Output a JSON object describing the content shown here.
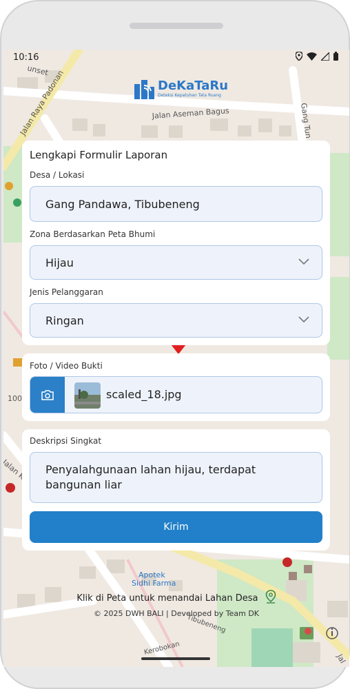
{
  "status_bar": {
    "time": "10:16"
  },
  "app": {
    "name": "DeKaTaRu",
    "tagline": "Deteksi Kepatuhan Tata Ruang"
  },
  "map_labels": {
    "road_1": "Jalan Raya Padonan",
    "road_2": "Jalan Aseman Bagus",
    "road_3": "Gang Tun",
    "road_4": "unset",
    "road_5": "Jalan K",
    "road_6": "Tibubeneng",
    "road_7": "Kerobokan",
    "poi_1": "Apotek",
    "poi_2": "Sidhi Farma",
    "number_1": "100",
    "street_edge": "Jal"
  },
  "form": {
    "title": "Lengkapi Formulir Laporan",
    "location_label": "Desa / Lokasi",
    "location_value": "Gang Pandawa, Tibubeneng",
    "zone_label": "Zona Berdasarkan Peta Bhumi",
    "zone_value": "Hijau",
    "violation_label": "Jenis Pelanggaran",
    "violation_value": "Ringan",
    "media_label": "Foto / Video Bukti",
    "media_filename": "scaled_18.jpg",
    "description_label": "Deskripsi Singkat",
    "description_value": "Penyalahgunaan lahan hijau, terdapat bangunan liar",
    "submit_label": "Kirim"
  },
  "footer": {
    "hint": "Klik di Peta untuk menandai Lahan Desa",
    "credit": "© 2025 DWH BALI | Developed by Team DK"
  },
  "colors": {
    "primary": "#2180c9",
    "field_bg": "#eef3fb",
    "field_border": "#aec6e6",
    "marker": "#e02020"
  }
}
